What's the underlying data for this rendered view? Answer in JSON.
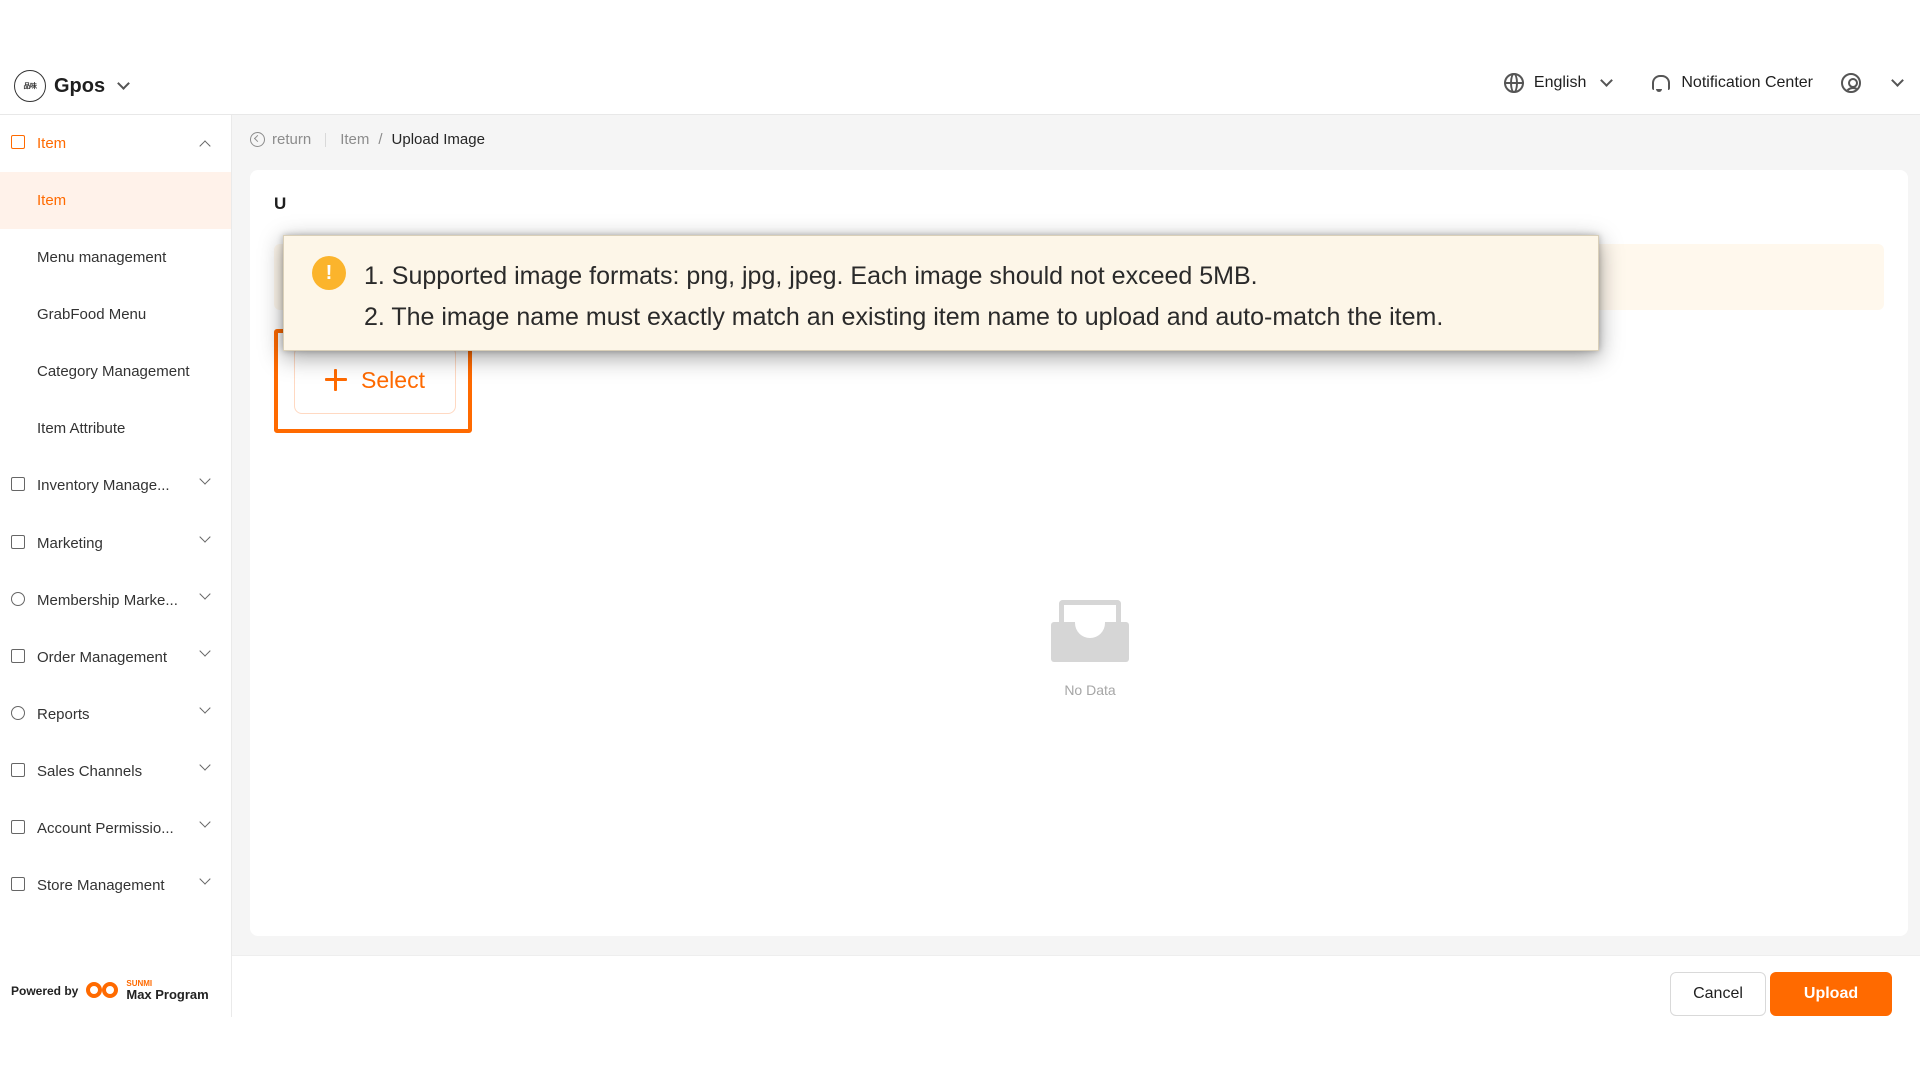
{
  "header": {
    "brand_logo_text": "品味",
    "brand_name": "Gpos",
    "language": "English",
    "notification": "Notification Center"
  },
  "sidebar": {
    "items": [
      {
        "label": "Item"
      },
      {
        "label": "Item"
      },
      {
        "label": "Menu management"
      },
      {
        "label": "GrabFood Menu"
      },
      {
        "label": "Category Management"
      },
      {
        "label": "Item Attribute"
      },
      {
        "label": "Inventory Manage..."
      },
      {
        "label": "Marketing"
      },
      {
        "label": "Membership Marke..."
      },
      {
        "label": "Order Management"
      },
      {
        "label": "Reports"
      },
      {
        "label": "Sales Channels"
      },
      {
        "label": "Account Permissio..."
      },
      {
        "label": "Store Management"
      }
    ],
    "powered_by": "Powered by",
    "max_sub": "SUNMI",
    "max_program": "Max Program"
  },
  "breadcrumb": {
    "return": "return",
    "parent": "Item",
    "separator": "/",
    "current": "Upload Image"
  },
  "card": {
    "title": "U"
  },
  "notice": {
    "line1": "1. Supported image formats: png, jpg, jpeg. Each image should not exceed 5MB.",
    "line2": "2. The image name must exactly match an existing item name to upload and auto-match the item."
  },
  "select_button": "Select",
  "empty_text": "No Data",
  "footer": {
    "cancel": "Cancel",
    "upload": "Upload"
  },
  "colors": {
    "accent": "#ff6a00",
    "warning": "#fbb42c"
  }
}
